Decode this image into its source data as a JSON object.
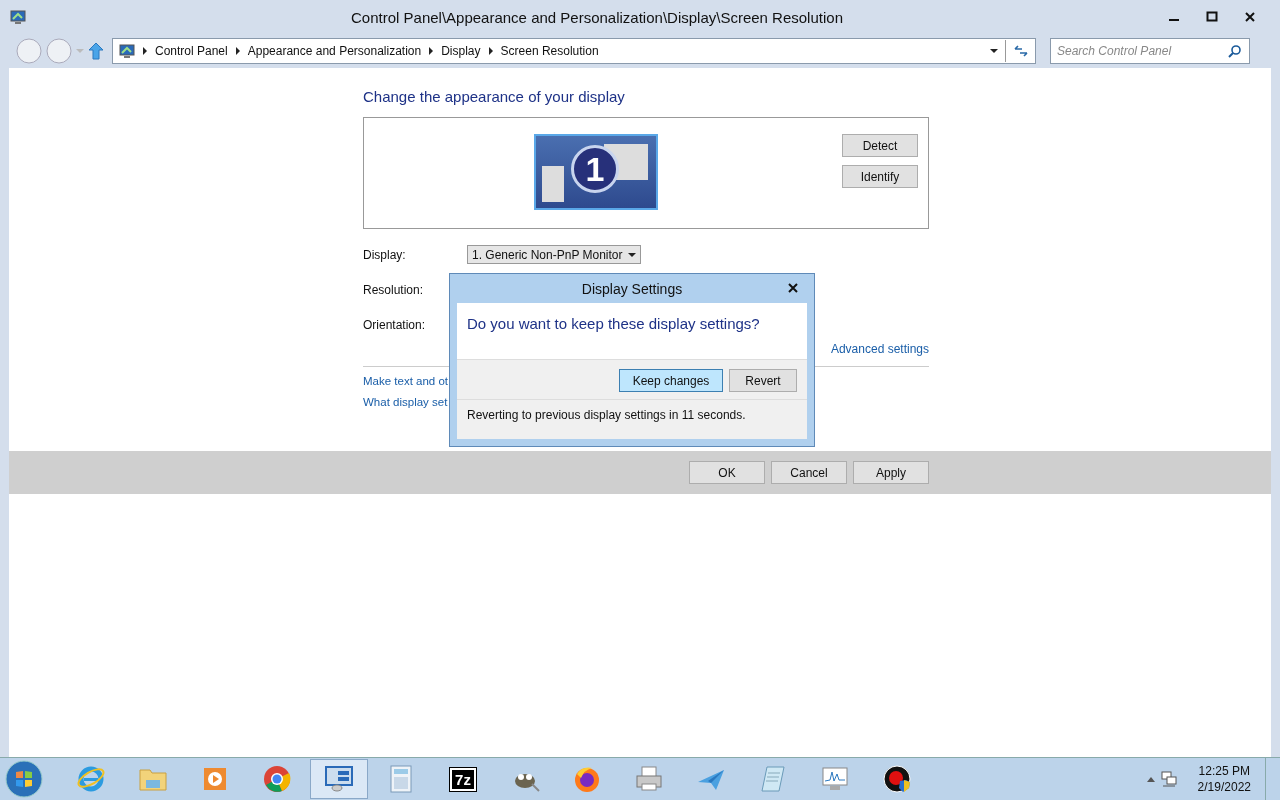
{
  "window": {
    "title": "Control Panel\\Appearance and Personalization\\Display\\Screen Resolution"
  },
  "address_bar": {
    "crumbs": [
      "Control Panel",
      "Appearance and Personalization",
      "Display",
      "Screen Resolution"
    ]
  },
  "search": {
    "placeholder": "Search Control Panel"
  },
  "content": {
    "heading": "Change the appearance of your display",
    "monitor_number": "1",
    "buttons": [
      "Detect",
      "Identify"
    ],
    "fields": [
      {
        "label": "Display:",
        "value": "1. Generic Non-PnP Monitor"
      },
      {
        "label": "Resolution:"
      },
      {
        "label": "Orientation:"
      }
    ],
    "advanced_link": "Advanced settings",
    "links": [
      "Make text and ot",
      "What display set"
    ]
  },
  "footer_buttons": [
    "OK",
    "Cancel",
    "Apply"
  ],
  "dialog": {
    "title": "Display Settings",
    "question": "Do you want to keep these display settings?",
    "buttons": [
      {
        "label": "Keep changes",
        "selected": true
      },
      {
        "label": "Revert",
        "selected": false
      }
    ],
    "status": "Reverting to previous display settings in 11 seconds."
  },
  "taskbar": {
    "items": [
      {
        "kind": "ie",
        "selected": false
      },
      {
        "kind": "folder",
        "selected": false
      },
      {
        "kind": "media",
        "selected": false
      },
      {
        "kind": "chrome",
        "selected": false
      },
      {
        "kind": "control",
        "selected": true
      },
      {
        "kind": "calculator",
        "selected": false
      },
      {
        "kind": "sevenzip",
        "label": "7z",
        "selected": false
      },
      {
        "kind": "gimp",
        "selected": false
      },
      {
        "kind": "firefox",
        "selected": false
      },
      {
        "kind": "printer",
        "selected": false
      },
      {
        "kind": "plane",
        "selected": false
      },
      {
        "kind": "notepad",
        "selected": false
      },
      {
        "kind": "monitor",
        "selected": false
      },
      {
        "kind": "recorder",
        "selected": false
      }
    ],
    "time": "12:25 PM",
    "date": "2/19/2022"
  }
}
